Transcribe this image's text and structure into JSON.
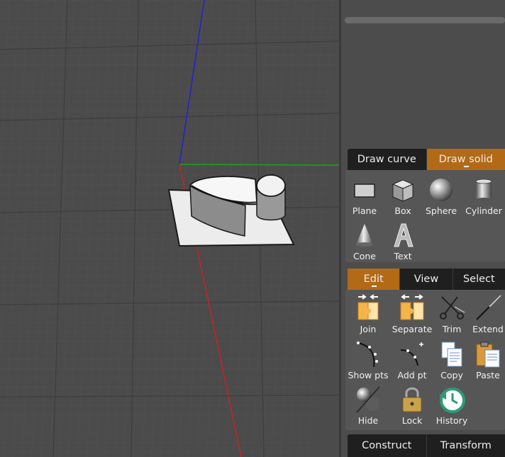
{
  "draw_tabs": [
    {
      "label": "Draw curve",
      "active": false
    },
    {
      "label": "Draw solid",
      "active": true
    }
  ],
  "draw_solid_tools": [
    {
      "label": "Plane",
      "icon": "plane-icon"
    },
    {
      "label": "Box",
      "icon": "box-icon"
    },
    {
      "label": "Sphere",
      "icon": "sphere-icon"
    },
    {
      "label": "Cylinder",
      "icon": "cylinder-icon"
    },
    {
      "label": "Cone",
      "icon": "cone-icon"
    },
    {
      "label": "Text",
      "icon": "text-icon"
    }
  ],
  "edit_tabs": [
    {
      "label": "Edit",
      "active": true
    },
    {
      "label": "View",
      "active": false
    },
    {
      "label": "Select",
      "active": false
    }
  ],
  "edit_tools": [
    {
      "label": "Join",
      "icon": "join-icon"
    },
    {
      "label": "Separate",
      "icon": "separate-icon"
    },
    {
      "label": "Trim",
      "icon": "scissors-icon"
    },
    {
      "label": "Extend",
      "icon": "extend-icon"
    },
    {
      "label": "Show pts",
      "icon": "show-points-icon"
    },
    {
      "label": "Add pt",
      "icon": "add-point-icon"
    },
    {
      "label": "Copy",
      "icon": "copy-icon"
    },
    {
      "label": "Paste",
      "icon": "paste-icon"
    },
    {
      "label": "Hide",
      "icon": "hide-icon"
    },
    {
      "label": "Lock",
      "icon": "lock-icon"
    },
    {
      "label": "History",
      "icon": "history-icon"
    }
  ],
  "bottom_tabs": [
    {
      "label": "Construct",
      "active": false
    },
    {
      "label": "Transform",
      "active": false
    }
  ],
  "colors": {
    "accent": "#b26a16",
    "axis_x": "#cc2020",
    "axis_y": "#1fa01f",
    "axis_z": "#2020d8"
  }
}
